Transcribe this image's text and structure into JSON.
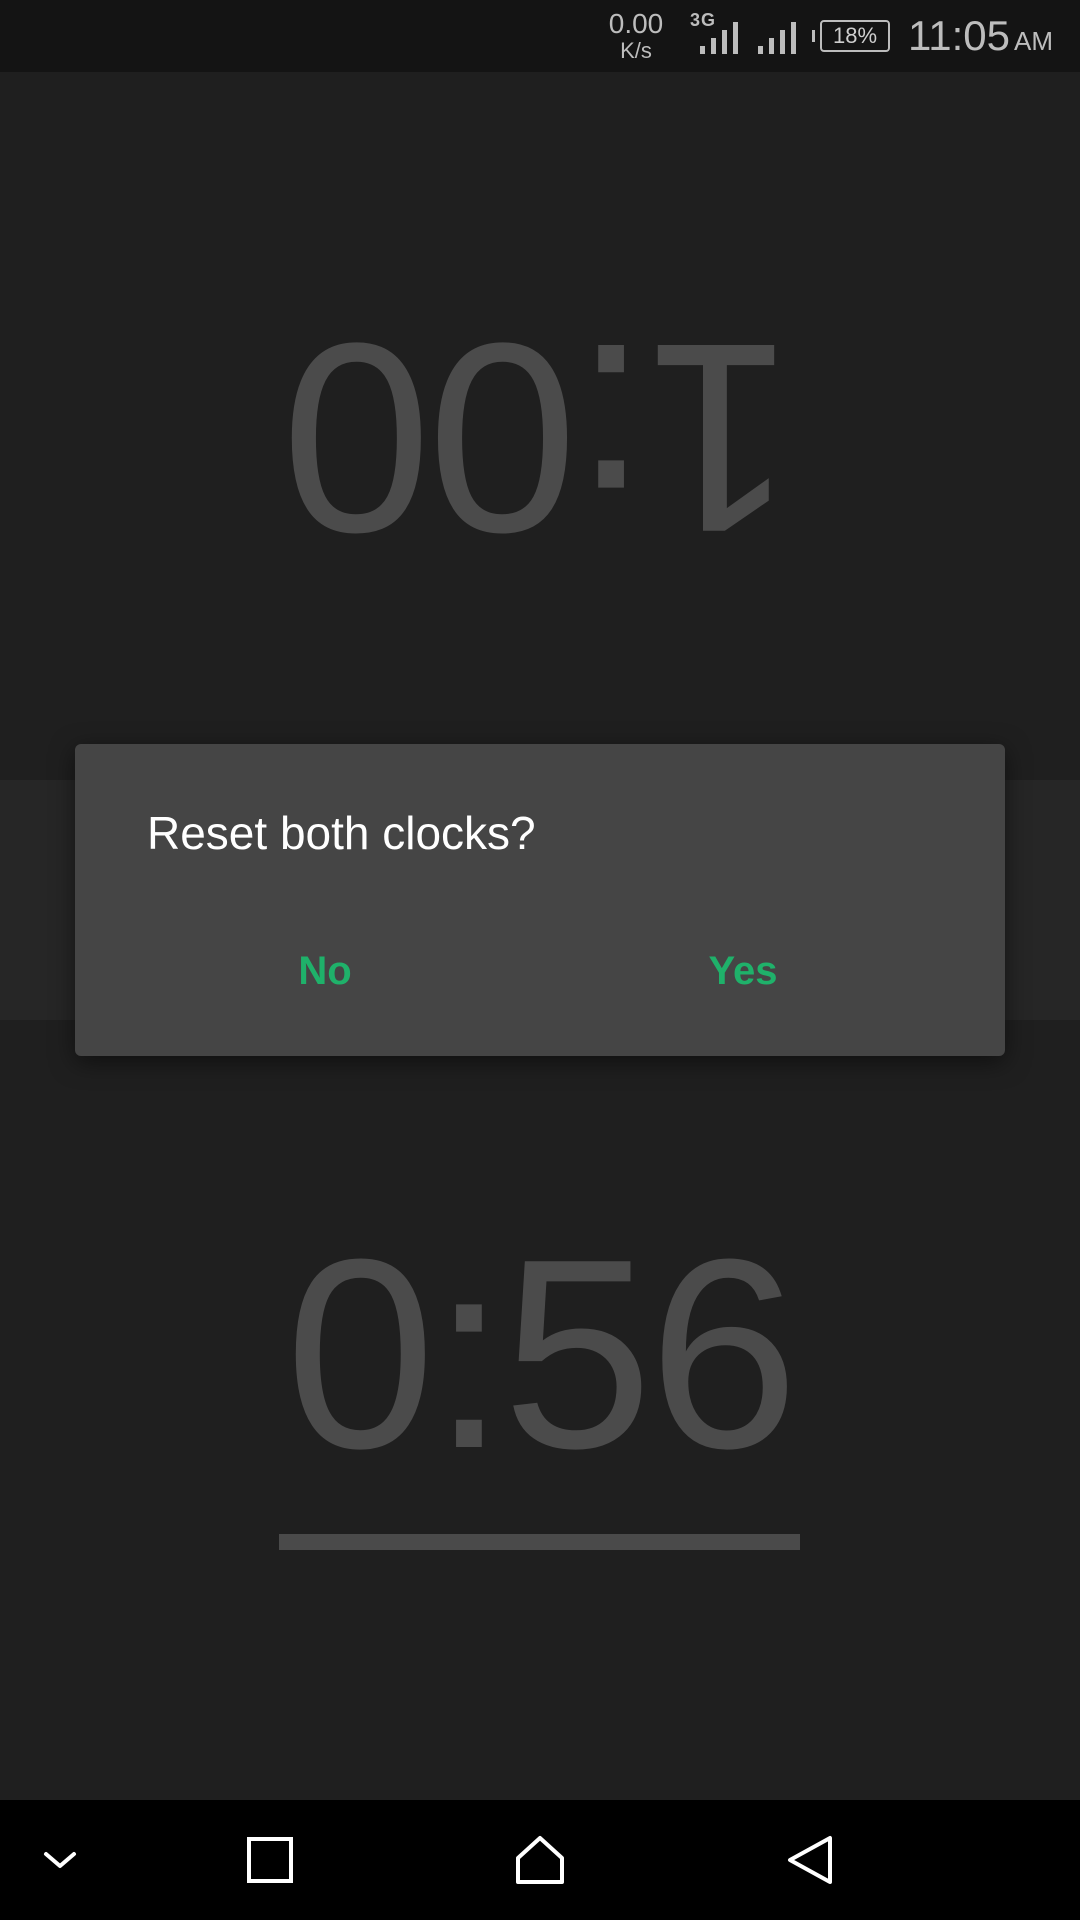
{
  "status_bar": {
    "net_speed_value": "0.00",
    "net_speed_unit": "K/s",
    "network_type": "3G",
    "battery": "18%",
    "time": "11:05",
    "ampm": "AM",
    "icons": [
      "signal-icon",
      "signal-icon",
      "battery-icon"
    ]
  },
  "clocks": {
    "top_player_time": "1:00",
    "bottom_player_time": "0:56",
    "bottom_progress": 1.0
  },
  "dialog": {
    "title": "Reset both clocks?",
    "no_label": "No",
    "yes_label": "Yes"
  },
  "nav_bar": {
    "icons": [
      "chevron-down-icon",
      "recent-apps-icon",
      "home-icon",
      "back-icon"
    ]
  },
  "colors": {
    "accent": "#1fb16a",
    "background": "#1f1f1f",
    "dialog": "#454545",
    "clock_text": "#4b4b4b"
  }
}
